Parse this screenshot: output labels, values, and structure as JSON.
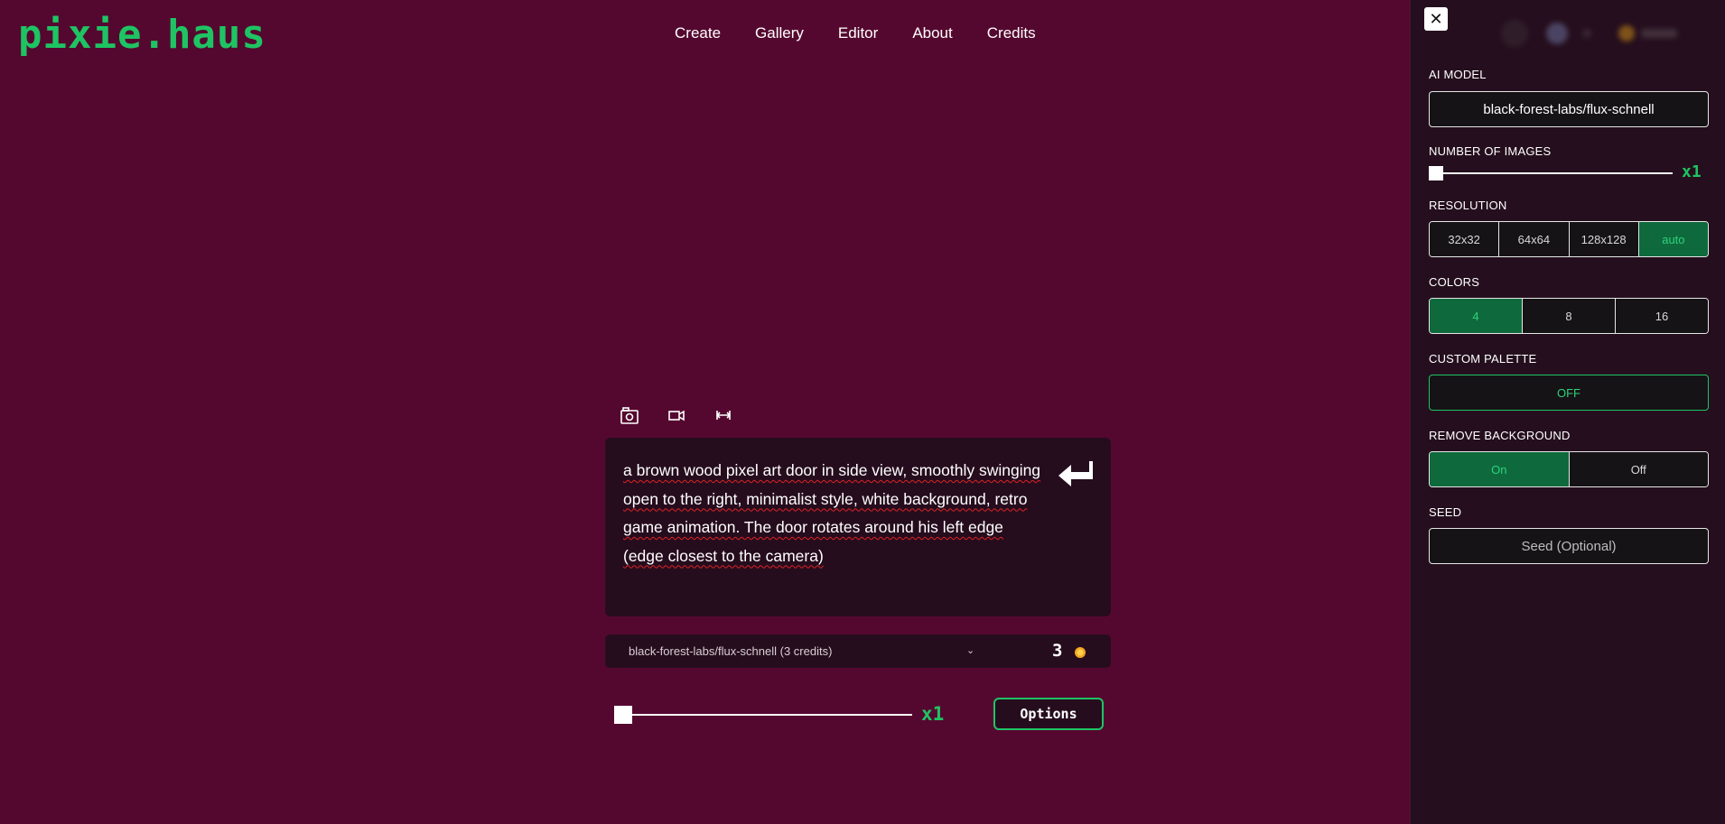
{
  "brand": {
    "logo": "pixie.haus",
    "accent_color": "#1ec463",
    "background": "#55082f"
  },
  "nav": {
    "items": [
      "Create",
      "Gallery",
      "Editor",
      "About",
      "Credits"
    ]
  },
  "toolbar": {
    "icons": [
      "image-mode-icon",
      "video-mode-icon",
      "resize-mode-icon"
    ]
  },
  "prompt": {
    "text": "a brown wood pixel art door in side view, smoothly swinging open to the right, minimalist style, white background, retro game animation.  The door rotates around his left edge (edge closest to the camera)",
    "submit_icon": "enter-arrow-icon"
  },
  "model_select": {
    "label": "black-forest-labs/flux-schnell (3 credits)",
    "cost": "3",
    "coin_icon": "coin-icon"
  },
  "count": {
    "value": 1,
    "label": "x1"
  },
  "options_button": "Options",
  "panel": {
    "close_label": "✕",
    "ai_model": {
      "title": "AI MODEL",
      "value": "black-forest-labs/flux-schnell"
    },
    "num_images": {
      "title": "NUMBER OF IMAGES",
      "label": "x1",
      "value": 1
    },
    "resolution": {
      "title": "RESOLUTION",
      "options": [
        "32x32",
        "64x64",
        "128x128",
        "auto"
      ],
      "selected": "auto"
    },
    "colors": {
      "title": "COLORS",
      "options": [
        "4",
        "8",
        "16"
      ],
      "selected": "4"
    },
    "custom_palette": {
      "title": "CUSTOM PALETTE",
      "value": "OFF"
    },
    "remove_background": {
      "title": "REMOVE BACKGROUND",
      "options": [
        "On",
        "Off"
      ],
      "selected": "On"
    },
    "seed": {
      "title": "SEED",
      "placeholder": "Seed (Optional)"
    }
  }
}
